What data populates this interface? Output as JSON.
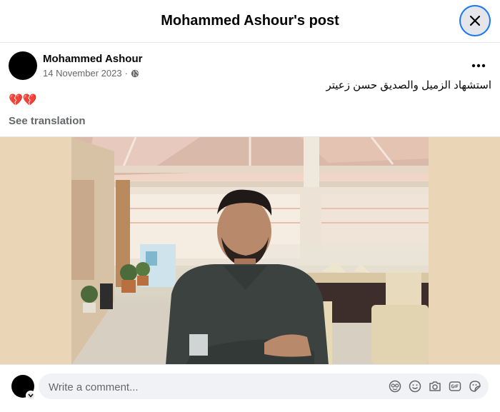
{
  "header": {
    "title": "Mohammed Ashour's post"
  },
  "post": {
    "author": "Mohammed Ashour",
    "date": "14 November 2023",
    "separator": "·",
    "text": "استشهاد الزميل  والصديق حسن زعيتر",
    "emoji": "💔💔",
    "see_translation": "See translation"
  },
  "composer": {
    "placeholder": "Write a comment..."
  },
  "icons": {
    "close": "close-icon",
    "more": "more-horizontal-icon",
    "privacy": "globe-icon",
    "avatar_badge": "chevron-down-icon",
    "composer_icons": [
      "avatar-sticker-icon",
      "emoji-icon",
      "camera-icon",
      "gif-icon",
      "sticker-icon"
    ]
  },
  "colors": {
    "accent": "#1877f2",
    "secondary_text": "#65676b",
    "photo_background": "#ead6b6"
  }
}
